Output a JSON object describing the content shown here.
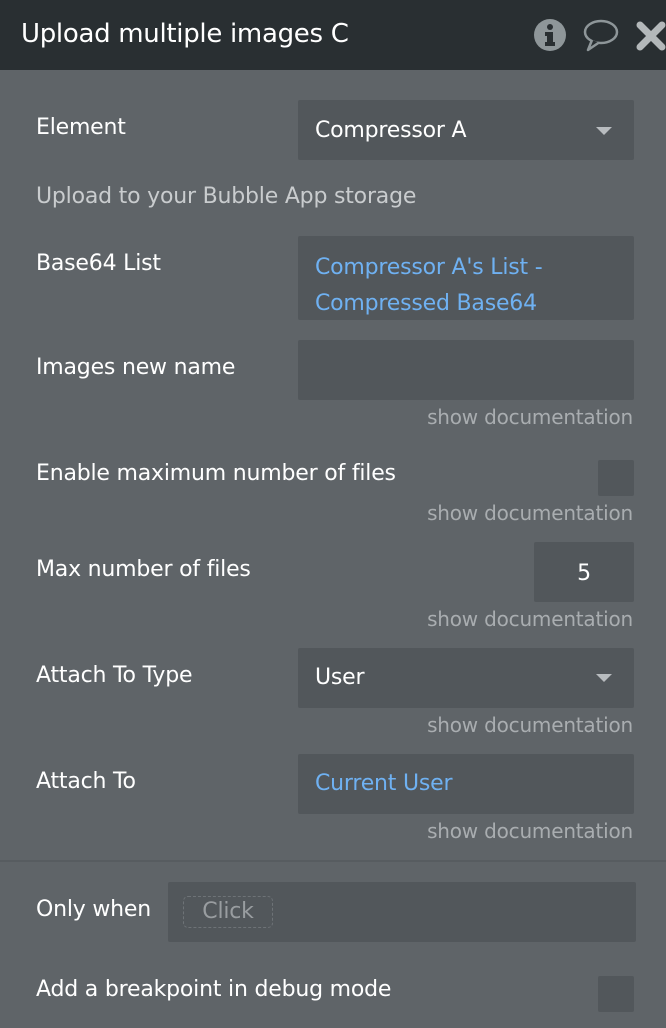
{
  "header": {
    "title": "Upload multiple images C",
    "icons": [
      "info-icon",
      "comment-icon",
      "close-icon"
    ]
  },
  "fields": {
    "element": {
      "label": "Element",
      "value": "Compressor A"
    },
    "subtitle": "Upload to your Bubble App storage",
    "base64_list": {
      "label": "Base64 List",
      "value_line1": "Compressor A's List -",
      "value_line2": "Compressed Base64"
    },
    "images_new_name": {
      "label": "Images new name",
      "value": ""
    },
    "enable_max": {
      "label": "Enable maximum number of files",
      "checked": false
    },
    "max_files": {
      "label": "Max number of files",
      "value": "5"
    },
    "attach_to_type": {
      "label": "Attach To Type",
      "value": "User"
    },
    "attach_to": {
      "label": "Attach To",
      "value": "Current User"
    },
    "show_documentation": "show documentation"
  },
  "conditions": {
    "only_when": {
      "label": "Only when",
      "placeholder": "Click"
    },
    "breakpoint": {
      "label": "Add a breakpoint in debug mode",
      "checked": false
    }
  },
  "colors": {
    "header_bg": "#292f32",
    "panel_bg": "#5f6468",
    "field_bg": "#52575b",
    "dynamic_text": "#6fb1f2",
    "muted_text": "#a9adb0"
  }
}
